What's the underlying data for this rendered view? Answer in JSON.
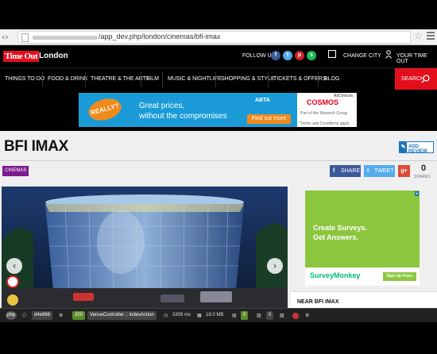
{
  "browser": {
    "url": "/app_dev.php/london/cinemas/bfi-imax"
  },
  "header": {
    "logo": "Time Out",
    "city": "London",
    "follow_label": "FOLLOW US",
    "change_city": "CHANGE CITY",
    "your_time_out": "YOUR TIME OUT",
    "social": [
      {
        "icon": "facebook-icon",
        "glyph": "f",
        "color": "#3b5998"
      },
      {
        "icon": "twitter-icon",
        "glyph": "t",
        "color": "#55acee"
      },
      {
        "icon": "pinterest-icon",
        "glyph": "p",
        "color": "#cb2027"
      },
      {
        "icon": "spotify-icon",
        "glyph": "s",
        "color": "#1db954"
      }
    ]
  },
  "nav": {
    "items": [
      "THINGS TO DO",
      "FOOD & DRINK",
      "THEATRE & THE ARTS",
      "FILM",
      "MUSIC & NIGHTLIFE",
      "SHOPPING & STYLE",
      "TICKETS & OFFERS",
      "BLOG"
    ],
    "search": "SEARCH"
  },
  "banner_ad": {
    "badge": "REALLY?",
    "line1": "Great prices,",
    "line2": "without the compromises",
    "abta": "ABTA",
    "cta": "Find out more",
    "brand": "COSMOS",
    "adchoices": "AdChoices",
    "part_of": "Part of the Monarch Group",
    "terms": "*Terms and Conditions apply"
  },
  "page": {
    "title": "BFI IMAX",
    "add_review": "ADD REVIEW",
    "category": "CINEMAS",
    "share": "SHARE",
    "tweet": "TWEET",
    "gplus": "g+",
    "share_count": "0",
    "shares_label": "SHARES",
    "near_title": "NEAR BFI IMAX"
  },
  "side_ad": {
    "line1": "Create Surveys.",
    "line2": "Get Answers.",
    "brand": "SurveyMonkey",
    "cta": "Sign Up Free»"
  },
  "debug": {
    "php": "php",
    "token": "d4e968",
    "status": "200",
    "controller": "VenueController :: indexAction",
    "time": "3309 ms",
    "memory": "18.0 MB",
    "count1": "0",
    "count2": "0"
  }
}
